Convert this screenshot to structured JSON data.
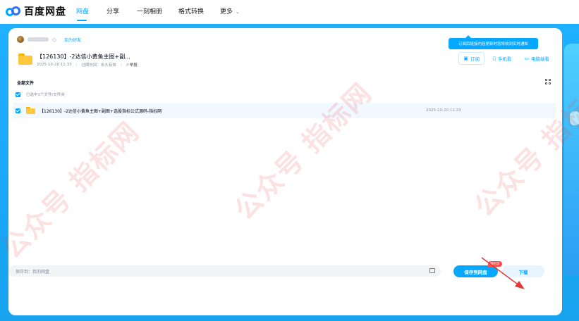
{
  "brand": {
    "name": "百度网盘"
  },
  "nav": {
    "items": [
      "网盘",
      "分享",
      "一刻相册",
      "格式转换",
      "更多"
    ],
    "active": "网盘"
  },
  "share": {
    "add_friend": "加为好友",
    "title": "【126130】-2达信小黄鱼主图+副...",
    "date": "2025-10-20 11:33",
    "expire": "过期时间：永久有效",
    "report": "举报"
  },
  "actions": {
    "subscribe": "订阅",
    "phone": "手机看",
    "pc": "电脑端看",
    "tooltip": "订阅后链接内容更新时您将收到实时通知"
  },
  "list": {
    "header": "全部文件",
    "selected": "已选中1个文件/文件夹",
    "rows": [
      {
        "name": "【126130】-2达信小黄鱼主图+副图+选股指标公式源码-指标网",
        "date": "2025-10-20 11:33"
      }
    ]
  },
  "footer": {
    "save_to": "保存到：我的网盘",
    "save_button": "保存到网盘",
    "badge": "限时享",
    "download_button": "下载"
  },
  "watermark": "公众号 指标网",
  "colors": {
    "accent": "#06a7ff",
    "folder": "#ffc83d",
    "annotation": "#e53935"
  }
}
